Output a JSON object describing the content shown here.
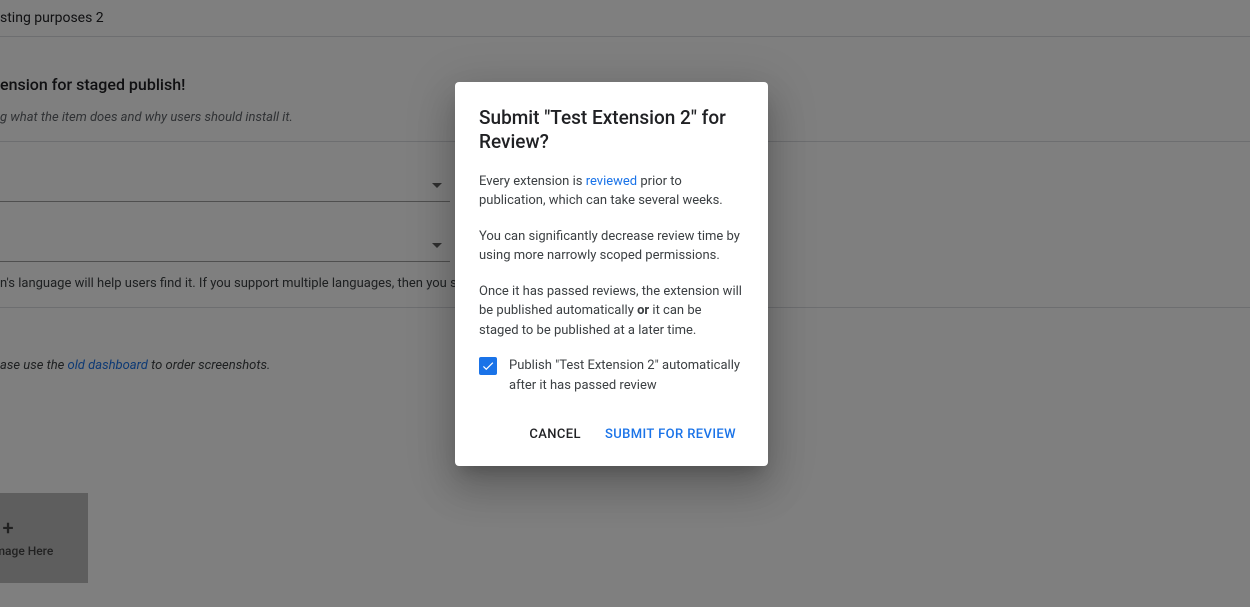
{
  "bg": {
    "title_partial": "sting purposes 2",
    "section_label": "ension for staged publish!",
    "field_helper": "g what the item does and why users should install it.",
    "language_note": "n's language will help users find it. If you support multiple languages, then you sl",
    "screenshot_note_prefix": "ase use the ",
    "screenshot_note_link": "old dashboard",
    "screenshot_note_suffix": " to order screenshots.",
    "drop_label": "Drop Image Here"
  },
  "dialog": {
    "title": "Submit \"Test Extension 2\" for Review?",
    "p1_prefix": "Every extension is ",
    "p1_link": "reviewed",
    "p1_suffix": " prior to publication, which can take several weeks.",
    "p2": "You can significantly decrease review time by using more narrowly scoped permissions.",
    "p3_prefix": "Once it has passed reviews, the extension will be published automatically ",
    "p3_bold": "or",
    "p3_suffix": " it can be staged to be published at a later time.",
    "checkbox_label": "Publish \"Test Extension 2\" automatically after it has passed review",
    "cancel": "Cancel",
    "submit": "Submit for Review"
  }
}
